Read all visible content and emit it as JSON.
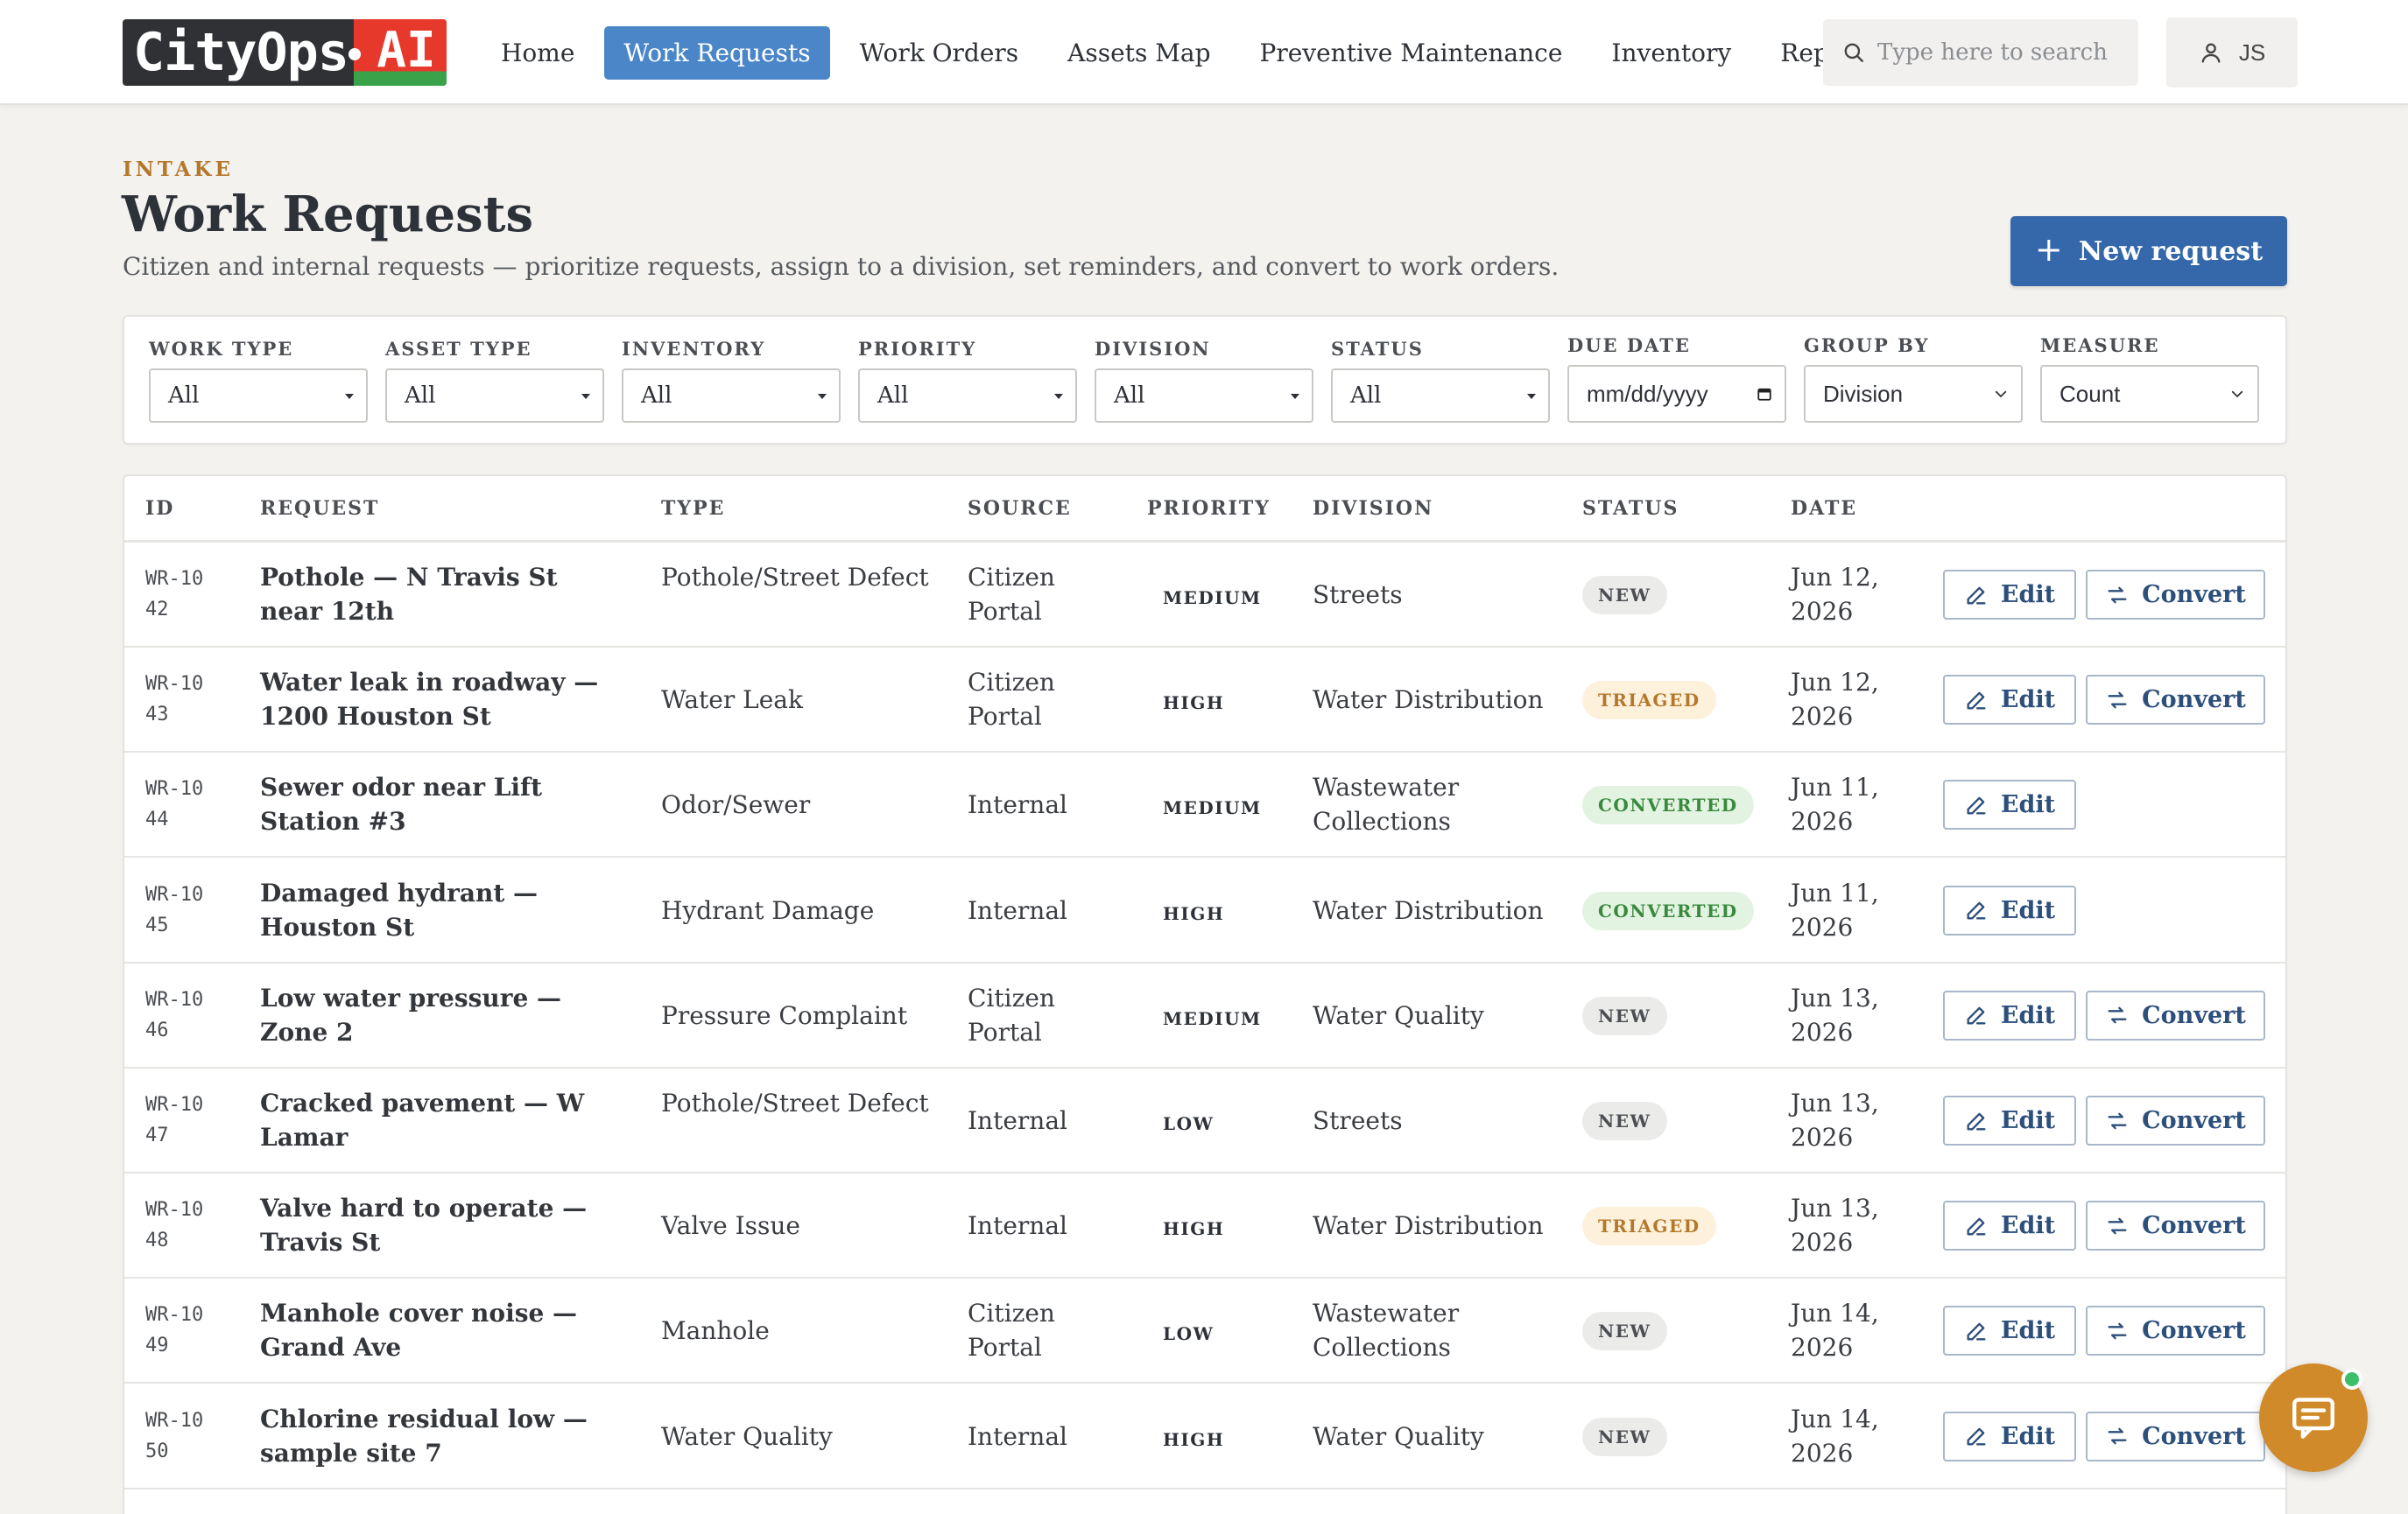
{
  "brand": {
    "name": "CityOps",
    "suffix": "AI"
  },
  "nav": {
    "items": [
      {
        "label": "Home",
        "active": false
      },
      {
        "label": "Work Requests",
        "active": true
      },
      {
        "label": "Work Orders",
        "active": false
      },
      {
        "label": "Assets Map",
        "active": false
      },
      {
        "label": "Preventive Maintenance",
        "active": false
      },
      {
        "label": "Inventory",
        "active": false
      },
      {
        "label": "Reports",
        "active": false
      }
    ],
    "search_placeholder": "Type here to search",
    "user_initials": "JS"
  },
  "header": {
    "eyebrow": "INTAKE",
    "title": "Work Requests",
    "subtitle": "Citizen and internal requests — prioritize requests, assign to a division, set reminders, and convert to work orders.",
    "new_button": "New request"
  },
  "filters": [
    {
      "label": "WORK TYPE",
      "value": "All"
    },
    {
      "label": "ASSET TYPE",
      "value": "All"
    },
    {
      "label": "INVENTORY",
      "value": "All"
    },
    {
      "label": "PRIORITY",
      "value": "All"
    },
    {
      "label": "DIVISION",
      "value": "All"
    },
    {
      "label": "STATUS",
      "value": "All"
    },
    {
      "label": "DUE DATE",
      "value": "mm/dd/yyyy"
    },
    {
      "label": "GROUP BY",
      "value": "Division"
    },
    {
      "label": "MEASURE",
      "value": "Count"
    }
  ],
  "table": {
    "columns": [
      "ID",
      "REQUEST",
      "TYPE",
      "SOURCE",
      "PRIORITY",
      "DIVISION",
      "STATUS",
      "DATE"
    ],
    "edit_label": "Edit",
    "convert_label": "Convert",
    "rows": [
      {
        "id": "WR-1042",
        "request": "Pothole — N Travis St near 12th",
        "type": "Pothole/Street Defect",
        "source": "Citizen Portal",
        "priority": "MEDIUM",
        "division": "Streets",
        "status": "NEW",
        "date": "Jun 12, 2026",
        "convertible": true
      },
      {
        "id": "WR-1043",
        "request": "Water leak in roadway — 1200 Houston St",
        "type": "Water Leak",
        "source": "Citizen Portal",
        "priority": "HIGH",
        "division": "Water Distribution",
        "status": "TRIAGED",
        "date": "Jun 12, 2026",
        "convertible": true
      },
      {
        "id": "WR-1044",
        "request": "Sewer odor near Lift Station #3",
        "type": "Odor/Sewer",
        "source": "Internal",
        "priority": "MEDIUM",
        "division": "Wastewater Collections",
        "status": "CONVERTED",
        "date": "Jun 11, 2026",
        "convertible": false
      },
      {
        "id": "WR-1045",
        "request": "Damaged hydrant — Houston St",
        "type": "Hydrant Damage",
        "source": "Internal",
        "priority": "HIGH",
        "division": "Water Distribution",
        "status": "CONVERTED",
        "date": "Jun 11, 2026",
        "convertible": false
      },
      {
        "id": "WR-1046",
        "request": "Low water pressure — Zone 2",
        "type": "Pressure Complaint",
        "source": "Citizen Portal",
        "priority": "MEDIUM",
        "division": "Water Quality",
        "status": "NEW",
        "date": "Jun 13, 2026",
        "convertible": true
      },
      {
        "id": "WR-1047",
        "request": "Cracked pavement — W Lamar",
        "type": "Pothole/Street Defect",
        "source": "Internal",
        "priority": "LOW",
        "division": "Streets",
        "status": "NEW",
        "date": "Jun 13, 2026",
        "convertible": true
      },
      {
        "id": "WR-1048",
        "request": "Valve hard to operate — Travis St",
        "type": "Valve Issue",
        "source": "Internal",
        "priority": "HIGH",
        "division": "Water Distribution",
        "status": "TRIAGED",
        "date": "Jun 13, 2026",
        "convertible": true
      },
      {
        "id": "WR-1049",
        "request": "Manhole cover noise — Grand Ave",
        "type": "Manhole",
        "source": "Citizen Portal",
        "priority": "LOW",
        "division": "Wastewater Collections",
        "status": "NEW",
        "date": "Jun 14, 2026",
        "convertible": true
      },
      {
        "id": "WR-1050",
        "request": "Chlorine residual low — sample site 7",
        "type": "Water Quality",
        "source": "Internal",
        "priority": "HIGH",
        "division": "Water Quality",
        "status": "NEW",
        "date": "Jun 14, 2026",
        "convertible": true
      }
    ]
  },
  "status_colors": {
    "NEW": {
      "bg": "#ebebe9",
      "fg": "#4b4e53"
    },
    "TRIAGED": {
      "bg": "#fdf1dc",
      "fg": "#b5782a"
    },
    "CONVERTED": {
      "bg": "#e3f3e1",
      "fg": "#3a8a3e"
    }
  },
  "colors": {
    "accent": "#3568ab",
    "nav_active": "#4a86c8",
    "eyebrow": "#b5782a",
    "chat": "#d08a2a"
  }
}
